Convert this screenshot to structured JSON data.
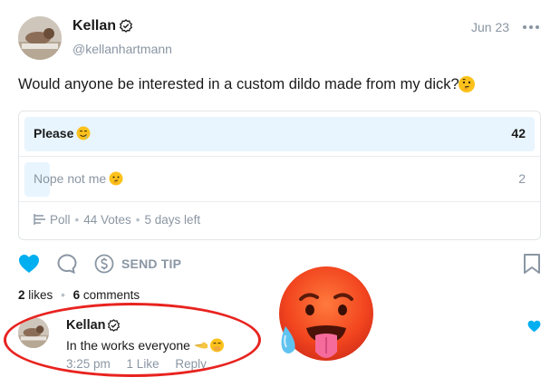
{
  "post": {
    "author": "Kellan",
    "handle": "@kellanhartmann",
    "date": "Jun 23",
    "text": "Would anyone be interested in a custom dildo made from my dick?",
    "text_emoji": "thinking-face-emoji"
  },
  "poll": {
    "options": [
      {
        "label": "Please",
        "emoji": "drooling-face-emoji",
        "count": "42",
        "fraction": 1.0
      },
      {
        "label": "Nope not me",
        "emoji": "thinking-face-emoji",
        "count": "2",
        "fraction": 0.05
      }
    ],
    "type_label": "Poll",
    "votes": "44 Votes",
    "time_left": "5 days left"
  },
  "actions": {
    "tip_label": "SEND TIP",
    "liked": true
  },
  "stats": {
    "likes_count": "2",
    "likes_label": "likes",
    "comments_count": "6",
    "comments_label": "comments"
  },
  "comment": {
    "author": "Kellan",
    "text": "In the works everyone",
    "emojis": [
      "pointing-hand-emoji",
      "grinning-hand-over-mouth-emoji"
    ],
    "time": "3:25 pm",
    "likes": "1 Like",
    "reply": "Reply",
    "liked": true
  },
  "overlay": {
    "sticker": "hot-face-emoji",
    "annotation": "red-ellipse-highlight"
  },
  "colors": {
    "accent": "#00aff0",
    "muted": "#8a96a3",
    "poll_fill": "#e8f5fe",
    "annotation_red": "#e8231f"
  }
}
